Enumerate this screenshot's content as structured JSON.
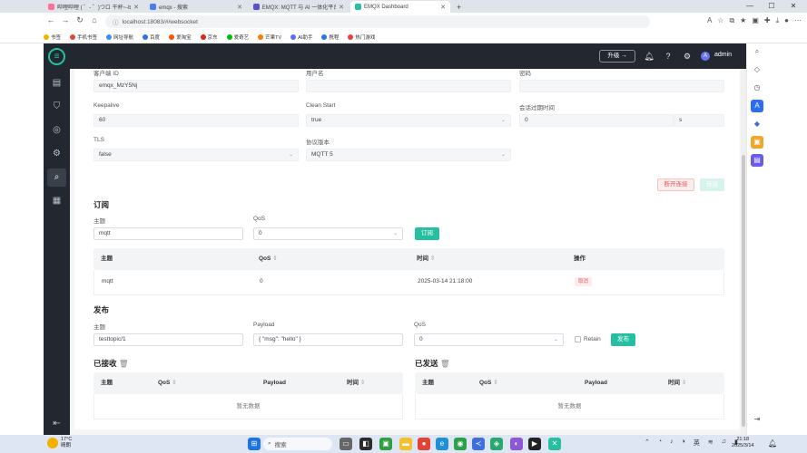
{
  "browser": {
    "tabs": [
      {
        "title": "哔哩哔哩 ( ゜- ゜)つロ 干杯~-bilib",
        "color": "#fb7299"
      },
      {
        "title": "emqx - 搜索",
        "color": "#4a7cf6"
      },
      {
        "title": "EMQX: MQTT 与 AI 一体化平台",
        "color": "#5d4ec9"
      },
      {
        "title": "EMQX Dashboard",
        "color": "#27bfa1"
      }
    ],
    "new_tab": "+",
    "url": "localhost:18083/#/websocket",
    "bookmarks": [
      "书签",
      "手机书签",
      "网址导航",
      "百度",
      "爱淘宝",
      "京东",
      "爱奇艺",
      "芒果TV",
      "AI助手",
      "携程",
      "热门游戏"
    ]
  },
  "header": {
    "upgrade_label": "升级",
    "user_initial": "A",
    "username": "admin"
  },
  "connection": {
    "client_id_label": "客户端 ID",
    "client_id": "emqx_MzY5Nj",
    "username_label": "用户名",
    "username": "",
    "password_label": "密码",
    "password": "",
    "keepalive_label": "Keepalive",
    "keepalive": "60",
    "clean_start_label": "Clean Start",
    "clean_start": "true",
    "session_expiry_label": "会话过期时间",
    "session_expiry": "0",
    "session_unit": "s",
    "tls_label": "TLS",
    "tls": "false",
    "protocol_label": "协议版本",
    "protocol": "MQTT 5",
    "disconnect_label": "断开连接",
    "connect_label": "连接"
  },
  "subscribe": {
    "title": "订阅",
    "topic_label": "主题",
    "topic": "mqtt",
    "qos_label": "QoS",
    "qos": "0",
    "button": "订阅",
    "columns": [
      "主题",
      "QoS",
      "时间",
      "操作"
    ],
    "rows": [
      {
        "topic": "mqtt",
        "qos": "0",
        "time": "2025-03-14 21:18:00",
        "action": "取消"
      }
    ]
  },
  "publish": {
    "title": "发布",
    "topic_label": "主题",
    "topic": "testtopic/1",
    "payload_label": "Payload",
    "payload": "{ \"msg\": \"hello\" }",
    "qos_label": "QoS",
    "qos": "0",
    "retain_label": "Retain",
    "button": "发布"
  },
  "received": {
    "title": "已接收",
    "columns": [
      "主题",
      "QoS",
      "Payload",
      "时间"
    ],
    "empty": "暂无数据"
  },
  "sent": {
    "title": "已发送",
    "columns": [
      "主题",
      "QoS",
      "Payload",
      "时间"
    ],
    "empty": "暂无数据"
  },
  "taskbar": {
    "weather_temp": "17°C",
    "weather_desc": "晴朗",
    "search_placeholder": "搜索",
    "ime": "英",
    "time": "21:18",
    "date": "2025/3/14"
  },
  "colors": {
    "accent": "#27bfa1",
    "sidebar": "#232830",
    "danger": "#e55b5b"
  }
}
